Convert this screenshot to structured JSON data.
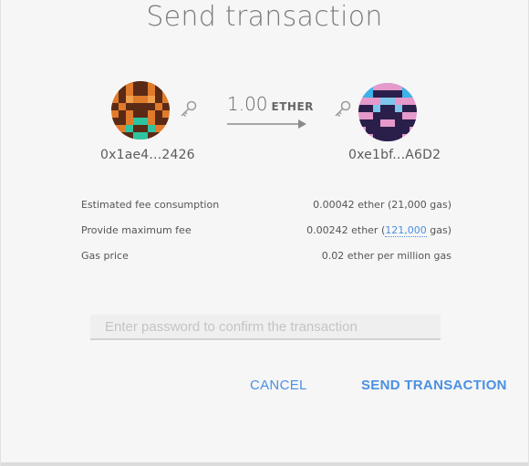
{
  "dialog": {
    "title": "Send transaction"
  },
  "transfer": {
    "from_address": "0x1ae4...2426",
    "to_address": "0xe1bf...A6D2",
    "amount": "1.00",
    "unit": "ETHER"
  },
  "details": {
    "fee_label": "Estimated fee consumption",
    "fee_value": "0.00042 ether (21,000 gas)",
    "max_fee_label": "Provide maximum fee",
    "max_fee_prefix": "0.00242 ether (",
    "max_fee_gas": "121,000",
    "max_fee_suffix": " gas)",
    "gas_price_label": "Gas price",
    "gas_price_value": "0.02 ether per million gas"
  },
  "password": {
    "placeholder": "Enter password to confirm the transaction",
    "value": ""
  },
  "actions": {
    "cancel_label": "CANCEL",
    "send_label": "SEND TRANSACTION"
  },
  "colors": {
    "accent": "#4a90e2",
    "background": "#f6f6f6"
  }
}
